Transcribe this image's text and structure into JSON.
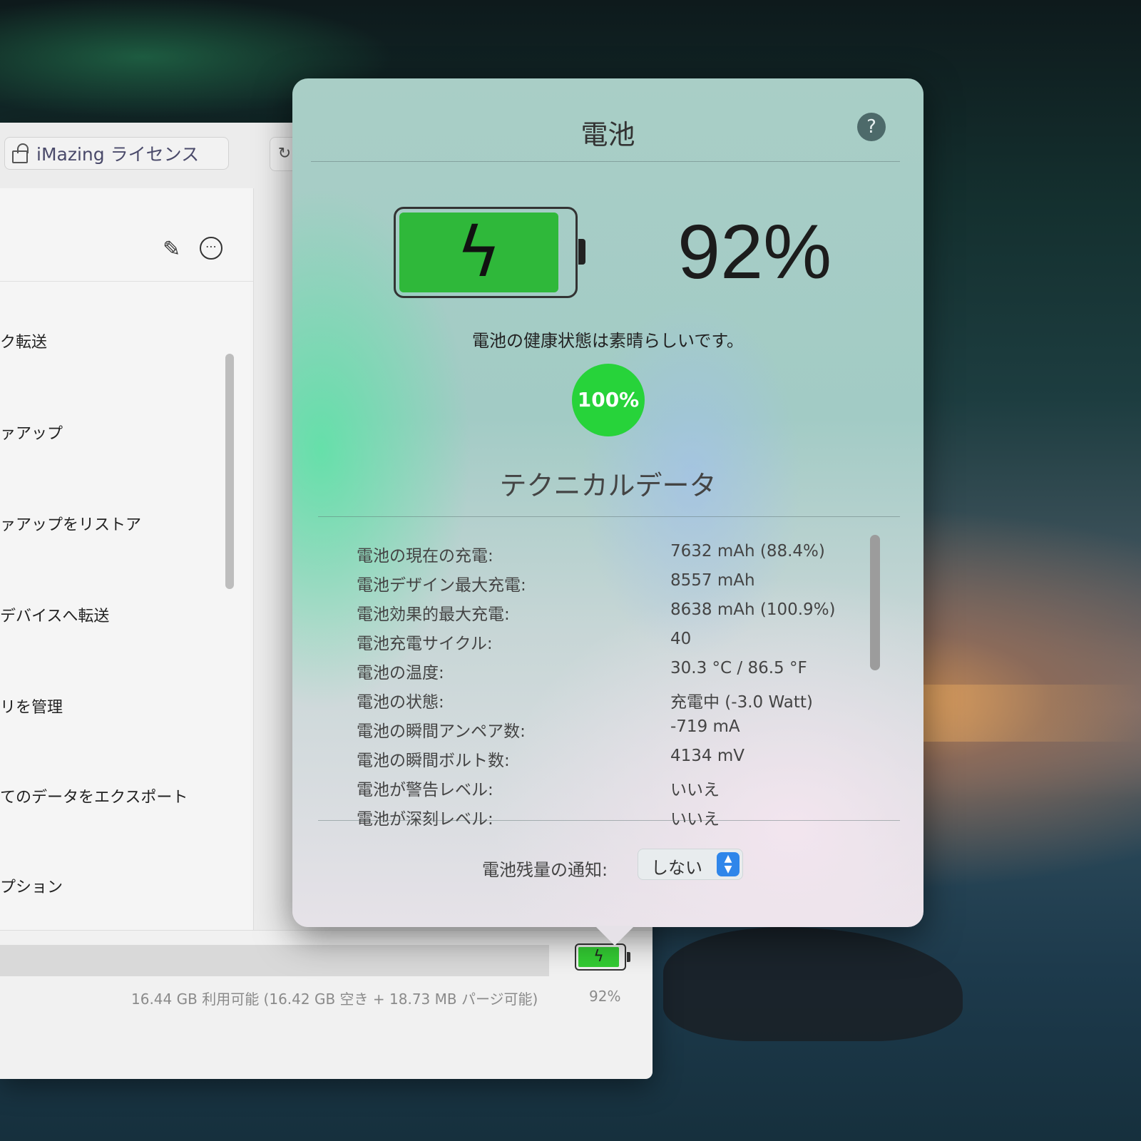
{
  "window": {
    "license_tab": "iMazing ライセンス",
    "list_items": [
      "ク転送",
      "ァアップ",
      "ァアップをリストア",
      "デバイスへ転送",
      "リを管理",
      "てのデータをエクスポート",
      "プション"
    ],
    "storage_text": "16.44 GB 利用可能 (16.42 GB 空き + 18.73 MB パージ可能)",
    "battery_percent": "92%"
  },
  "popover": {
    "title": "電池",
    "help_label": "?",
    "charge_percent": "92%",
    "charge_level": 0.92,
    "health_text": "電池の健康状態は素晴らしいです。",
    "health_badge": "100%",
    "tech_title": "テクニカルデータ",
    "tech_rows": [
      {
        "label": "電池の現在の充電:",
        "value": "7632 mAh (88.4%)"
      },
      {
        "label": "電池デザイン最大充電:",
        "value": "8557 mAh"
      },
      {
        "label": "電池効果的最大充電:",
        "value": "8638 mAh (100.9%)"
      },
      {
        "label": "電池充電サイクル:",
        "value": "40"
      },
      {
        "label": "電池の温度:",
        "value": "30.3 °C / 86.5 °F"
      },
      {
        "label": "電池の状態:",
        "value": "充電中 (-3.0 Watt)"
      },
      {
        "label": "電池の瞬間アンペア数:",
        "value": "-719 mA"
      },
      {
        "label": "電池の瞬間ボルト数:",
        "value": "4134 mV"
      },
      {
        "label": "電池が警告レベル:",
        "value": "いいえ"
      },
      {
        "label": "電池が深刻レベル:",
        "value": "いいえ"
      }
    ],
    "notify_label": "電池残量の通知:",
    "notify_value": "しない"
  },
  "colors": {
    "battery_green": "#2fb83a",
    "badge_green": "#27d33a",
    "select_blue": "#2f86ea"
  },
  "icons": {
    "lock": "lock-icon",
    "edit": "pencil-icon",
    "more": "more-icon",
    "bolt": "bolt-icon",
    "help": "help-icon",
    "stepper": "stepper-icon"
  }
}
